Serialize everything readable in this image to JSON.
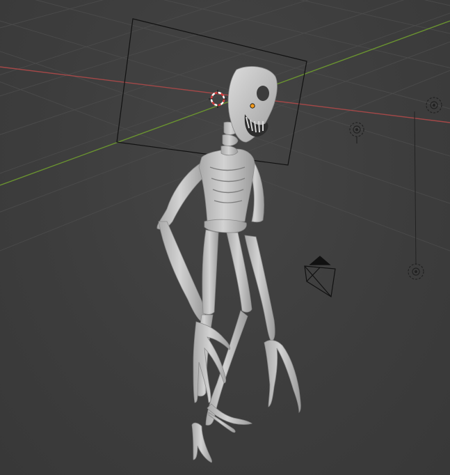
{
  "viewport": {
    "background_color": "#3d3d3d",
    "grid_color": "#4a4a4a",
    "x_axis_color": "#b04a4a",
    "y_axis_color": "#6f9a32",
    "model_color": "#c8c8c8",
    "selection_outline_color": "#e6901a"
  },
  "objects": {
    "mesh": "skeleton-creature",
    "icons": [
      "camera-frame-icon",
      "3d-cursor-icon",
      "origin-point-icon",
      "light-icon",
      "light-icon",
      "light-icon",
      "camera-icon"
    ]
  }
}
